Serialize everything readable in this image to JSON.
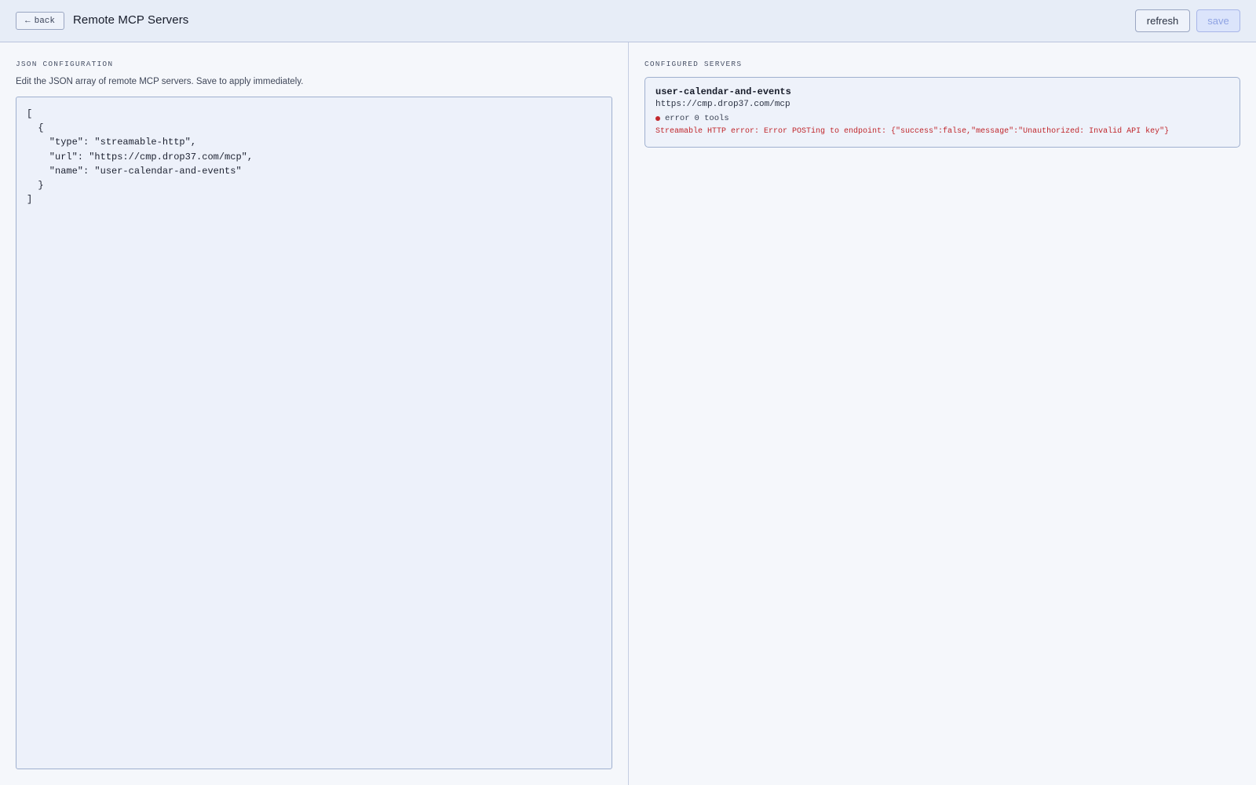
{
  "header": {
    "back_arrow": "←",
    "back_label": "back",
    "title": "Remote MCP Servers",
    "refresh_label": "refresh",
    "save_label": "save"
  },
  "left_panel": {
    "section_label": "JSON CONFIGURATION",
    "help_text": "Edit the JSON array of remote MCP servers. Save to apply immediately.",
    "editor_value": "[\n  {\n    \"type\": \"streamable-http\",\n    \"url\": \"https://cmp.drop37.com/mcp\",\n    \"name\": \"user-calendar-and-events\"\n  }\n]"
  },
  "right_panel": {
    "section_label": "CONFIGURED SERVERS",
    "servers": [
      {
        "name": "user-calendar-and-events",
        "url": "https://cmp.drop37.com/mcp",
        "status": "error",
        "tools": "0 tools",
        "error": "Streamable HTTP error: Error POSTing to endpoint: {\"success\":false,\"message\":\"Unauthorized: Invalid API key\"}"
      }
    ]
  },
  "colors": {
    "header_bg": "#e7edf7",
    "page_bg": "#f5f7fb",
    "accent": "#a8b6e8",
    "error": "#c2282d"
  },
  "icons": {
    "back": "arrow-left-icon",
    "status": "status-dot-icon"
  }
}
